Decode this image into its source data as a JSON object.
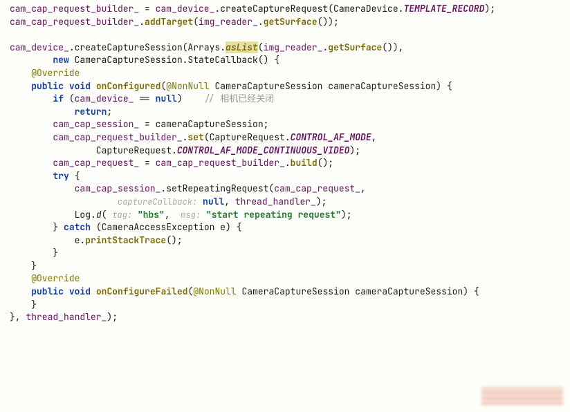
{
  "l1": {
    "a": "cam_cap_request_builder_",
    "b": " = ",
    "c": "cam_device_",
    "d": ".createCaptureRequest(CameraDevice.",
    "e": "TEMPLATE_RECORD",
    "f": ");"
  },
  "l2": {
    "a": "cam_cap_request_builder_",
    "b": ".",
    "c": "addTarget",
    "d": "(",
    "e": "img_reader_",
    "f": ".",
    "g": "getSurface",
    "h": "());"
  },
  "l3": {
    "a": "cam_device_",
    "b": ".createCaptureSession(Arrays.",
    "c": "asList",
    "d": "(",
    "e": "img_reader_",
    "f": ".",
    "g": "getSurface",
    "h": "()),"
  },
  "l4": {
    "a": "        ",
    "b": "new",
    "c": " CameraCaptureSession.StateCallback() {"
  },
  "l5": {
    "a": "    ",
    "b": "@Override"
  },
  "l6": {
    "a": "    ",
    "b": "public",
    "c": " ",
    "d": "void",
    "e": " ",
    "f": "onConfigured",
    "g": "(",
    "h": "@NonNull",
    "i": " CameraCaptureSession cameraCaptureSession) {"
  },
  "l7": {
    "a": "        ",
    "b": "if",
    "c": " (",
    "d": "cam_device_",
    "e": " == ",
    "f": "null",
    "g": ")    ",
    "h": "// 相机已经关闭"
  },
  "l8": {
    "a": "            ",
    "b": "return",
    "c": ";"
  },
  "l9": {
    "a": ""
  },
  "l10": {
    "a": "        ",
    "b": "cam_cap_session_",
    "c": " = cameraCaptureSession;"
  },
  "l11": {
    "a": ""
  },
  "l12": {
    "a": "        ",
    "b": "cam_cap_request_builder_",
    "c": ".",
    "d": "set",
    "e": "(CaptureRequest.",
    "f": "CONTROL_AF_MODE",
    "g": ","
  },
  "l13": {
    "a": "                CaptureRequest.",
    "b": "CONTROL_AF_MODE_CONTINUOUS_VIDEO",
    "c": ");"
  },
  "l14": {
    "a": ""
  },
  "l15": {
    "a": "        ",
    "b": "cam_cap_request_",
    "c": " = ",
    "d": "cam_cap_request_builder_",
    "e": ".",
    "f": "build",
    "g": "();"
  },
  "l16": {
    "a": "        ",
    "b": "try",
    "c": " {"
  },
  "l17": {
    "a": "            ",
    "b": "cam_cap_session_",
    "c": ".setRepeatingRequest(",
    "d": "cam_cap_request_",
    "e": ","
  },
  "l18": {
    "a": "                    ",
    "b": "captureCallback:",
    "c": " ",
    "d": "null",
    "e": ", ",
    "f": "thread_handler_",
    "g": ");"
  },
  "l19": {
    "a": ""
  },
  "l20": {
    "a": "            Log.",
    "b": "d",
    "c": "( ",
    "d": "tag:",
    "e": " ",
    "f": "\"hbs\"",
    "g": ",  ",
    "h": "msg:",
    "i": " ",
    "j": "\"start repeating request\"",
    "k": ");"
  },
  "l21": {
    "a": "        } ",
    "b": "catch",
    "c": " (CameraAccessException e) {"
  },
  "l22": {
    "a": "            e.",
    "b": "printStackTrace",
    "c": "();"
  },
  "l23": {
    "a": "        }"
  },
  "l24": {
    "a": "    }"
  },
  "l25": {
    "a": ""
  },
  "l26": {
    "a": "    ",
    "b": "@Override"
  },
  "l27": {
    "a": "    ",
    "b": "public",
    "c": " ",
    "d": "void",
    "e": " ",
    "f": "onConfigureFailed",
    "g": "(",
    "h": "@NonNull",
    "i": " CameraCaptureSession cameraCaptureSession) {"
  },
  "l28": {
    "a": ""
  },
  "l29": {
    "a": "    }"
  },
  "l30": {
    "a": "}, ",
    "b": "thread_handler_",
    "c": ");"
  }
}
